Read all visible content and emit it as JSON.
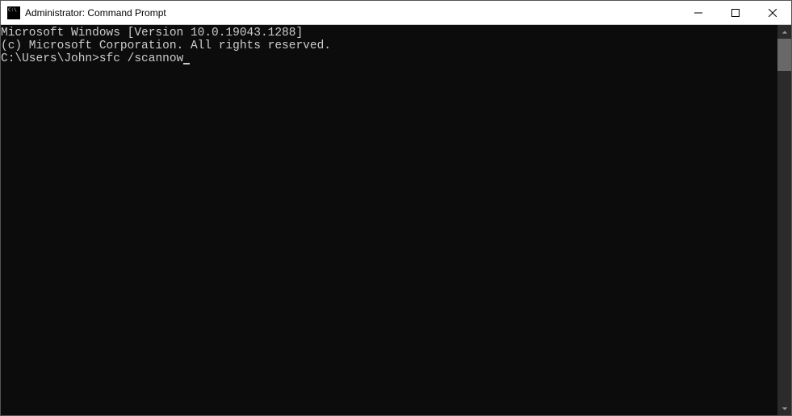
{
  "window": {
    "title": "Administrator: Command Prompt"
  },
  "terminal": {
    "line1": "Microsoft Windows [Version 10.0.19043.1288]",
    "line2": "(c) Microsoft Corporation. All rights reserved.",
    "blank": "",
    "prompt": "C:\\Users\\John>",
    "command": "sfc /scannow"
  }
}
